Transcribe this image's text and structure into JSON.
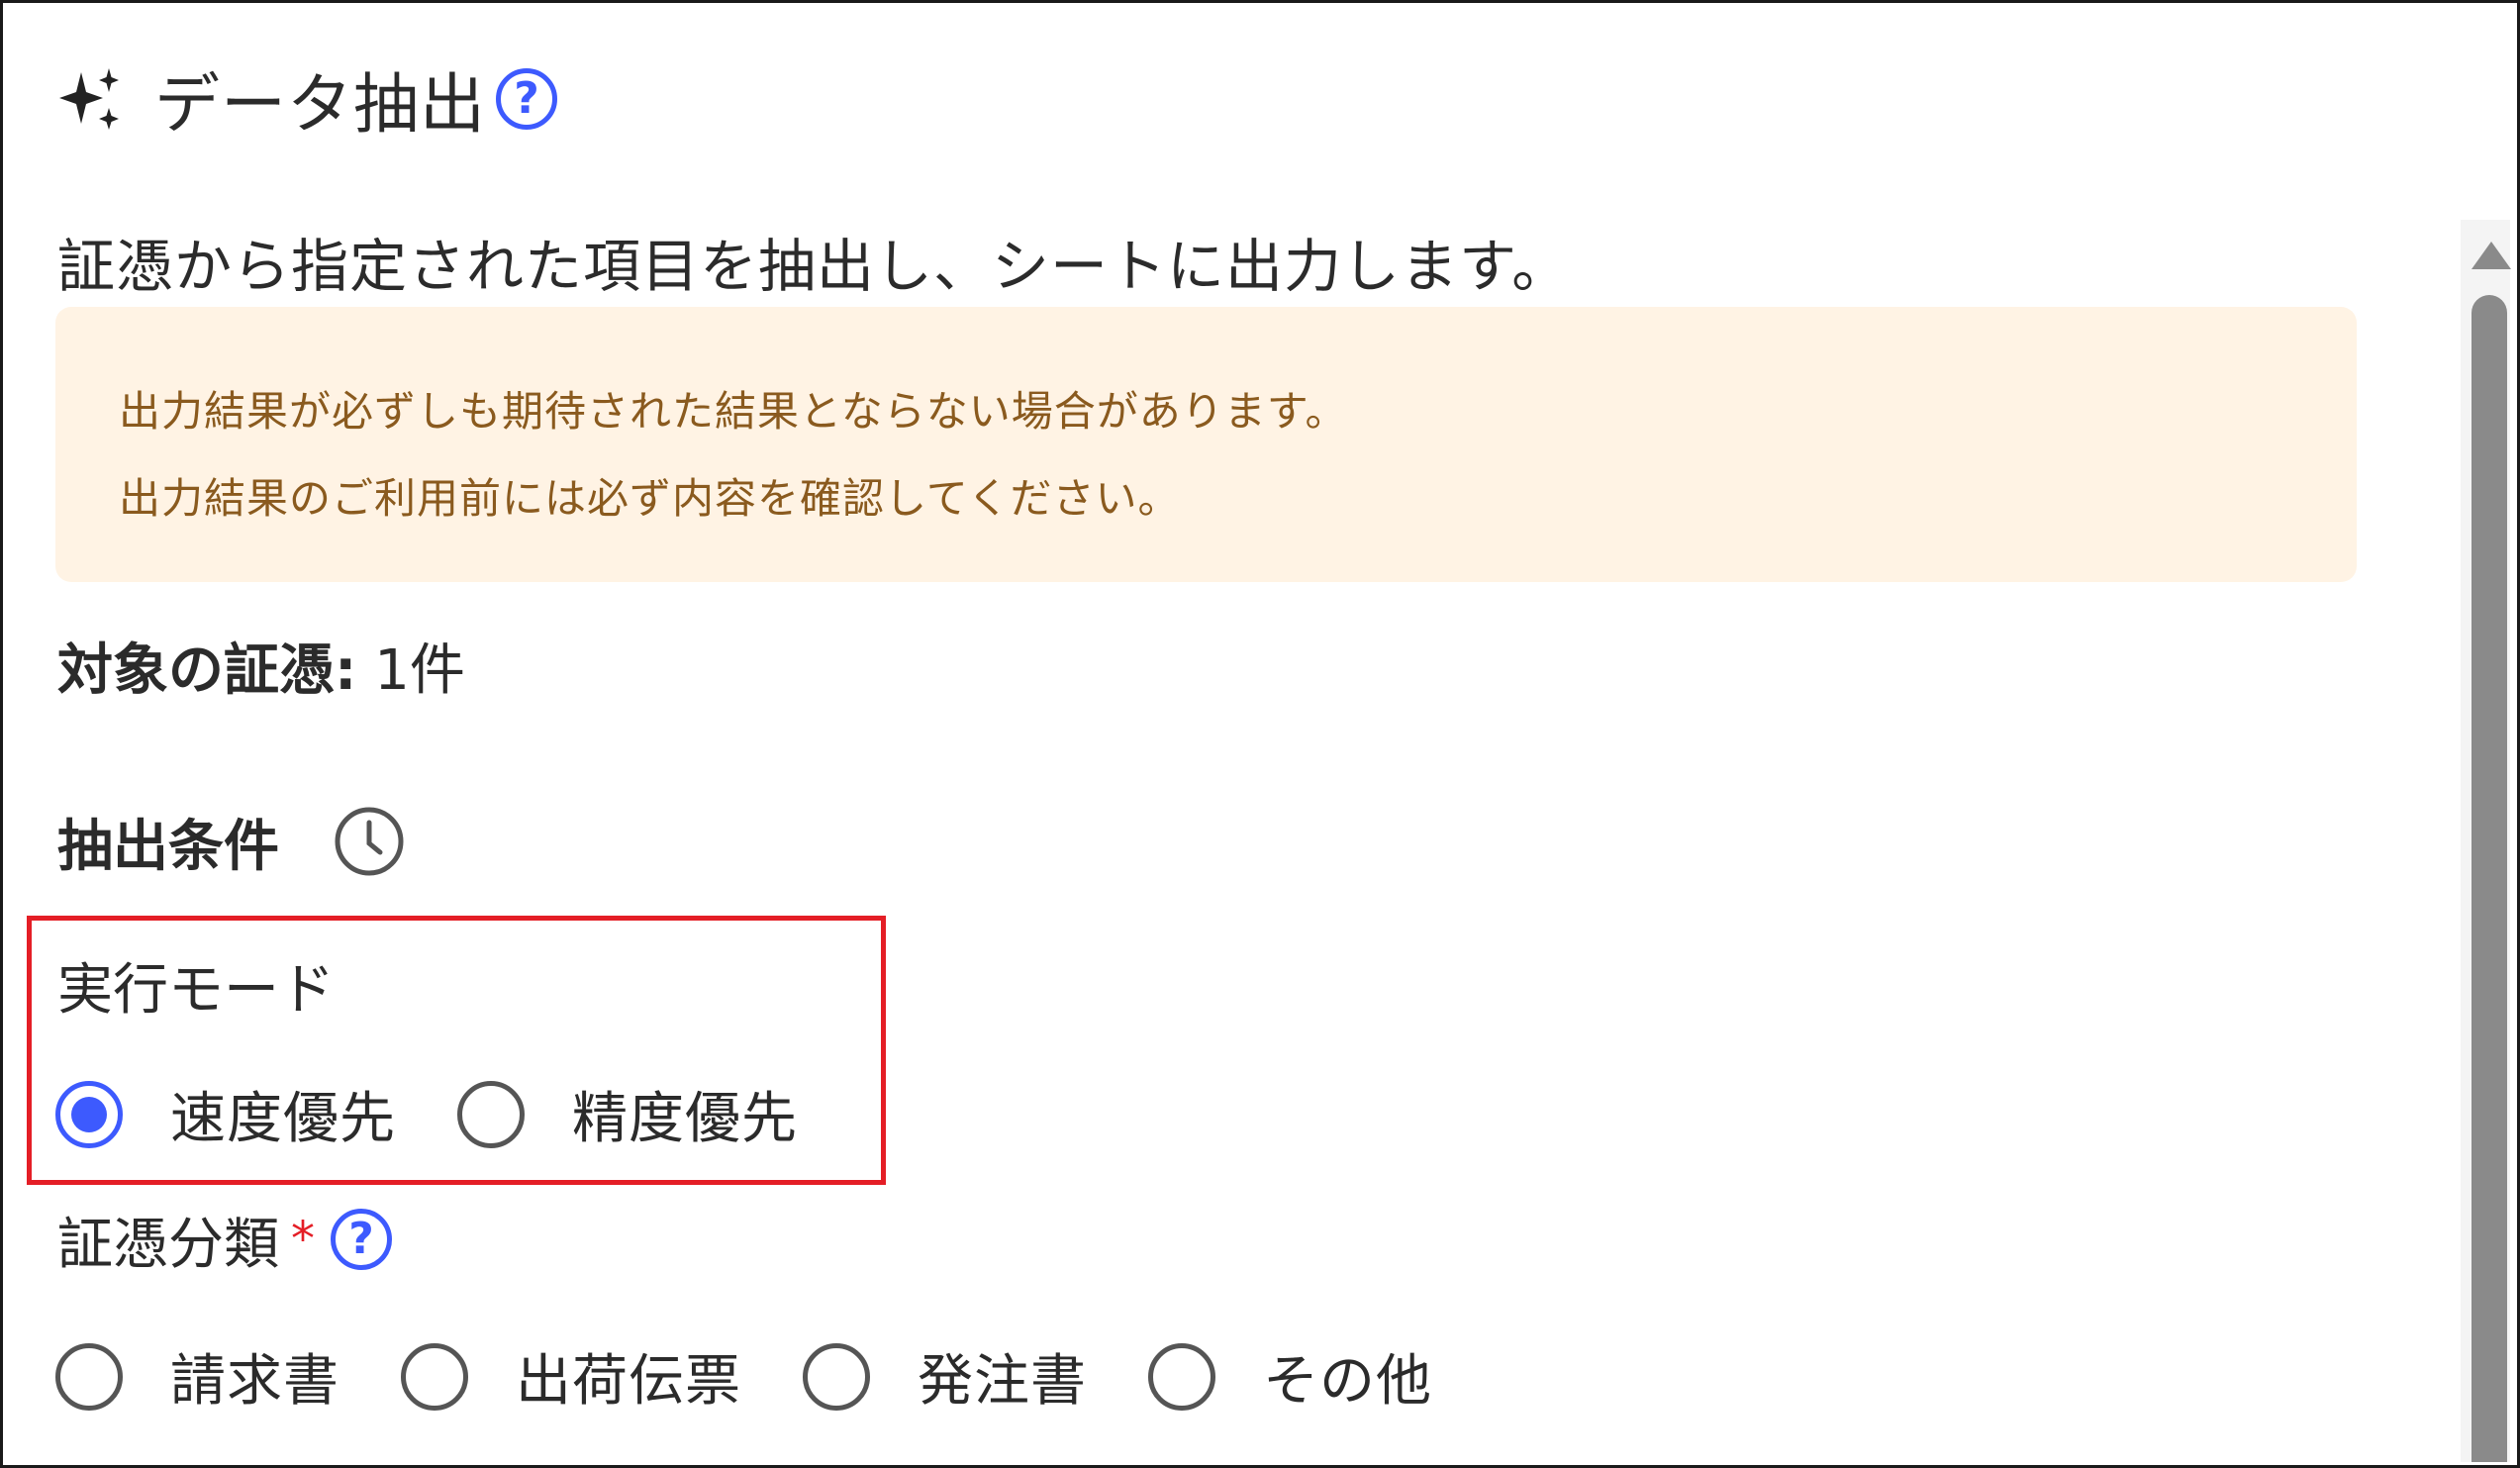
{
  "header": {
    "title": "データ抽出",
    "help_glyph": "?",
    "icon": "sparkle-icon"
  },
  "description": "証憑から指定された項目を抽出し、シートに出力します。",
  "notice": {
    "lines": [
      "出力結果が必ずしも期待された結果とならない場合があります。",
      "出力結果のご利用前には必ず内容を確認してください。"
    ]
  },
  "target": {
    "label": "対象の証憑:",
    "value": " 1件"
  },
  "conditions": {
    "label": "抽出条件",
    "icon": "history-icon"
  },
  "mode": {
    "label": "実行モード",
    "options": [
      {
        "label": "速度優先",
        "selected": true
      },
      {
        "label": "精度優先",
        "selected": false
      }
    ]
  },
  "category": {
    "label": "証憑分類",
    "required_mark": "*",
    "help_glyph": "?",
    "options": [
      {
        "label": "請求書",
        "selected": false
      },
      {
        "label": "出荷伝票",
        "selected": false
      },
      {
        "label": "発注書",
        "selected": false
      },
      {
        "label": "その他",
        "selected": false
      }
    ]
  },
  "colors": {
    "accent": "#3d5afe",
    "highlight_box": "#e41e26",
    "notice_bg": "#fff3e4",
    "notice_text": "#8a5a1e"
  }
}
